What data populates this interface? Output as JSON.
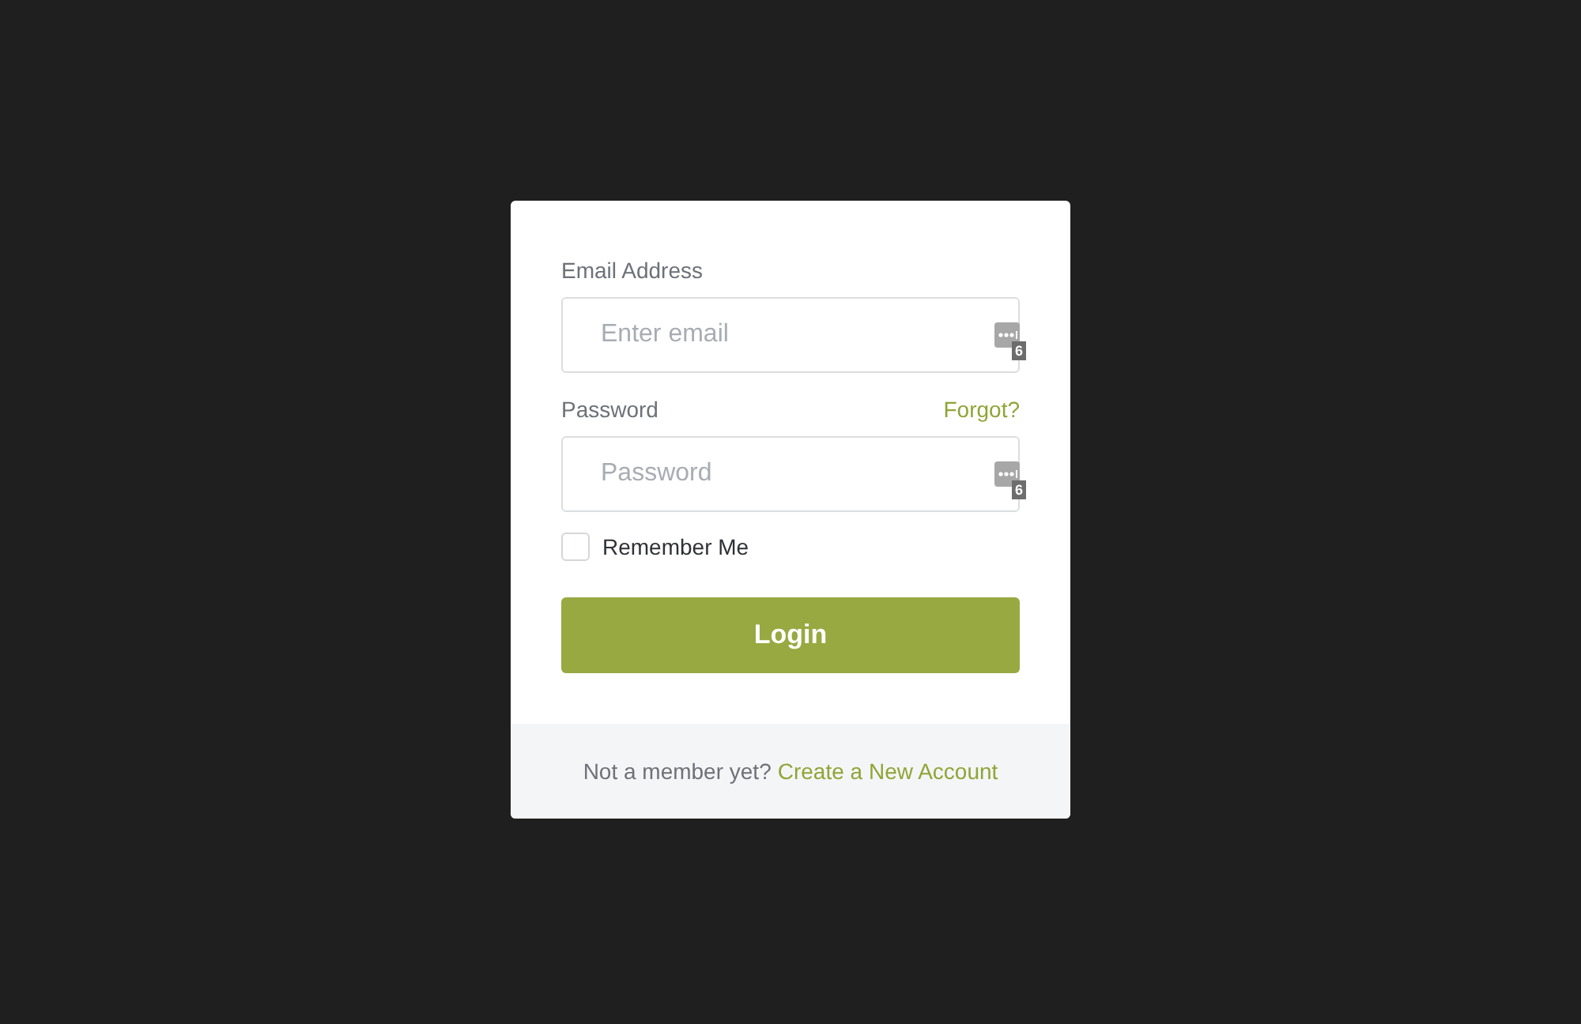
{
  "form": {
    "fields": [
      {
        "label": "Email Address",
        "placeholder": "Enter email",
        "badge": "6"
      },
      {
        "label": "Password",
        "link": "Forgot?",
        "placeholder": "Password",
        "badge": "6"
      }
    ],
    "remember": {
      "label": "Remember Me",
      "checked": false
    },
    "submit": "Login"
  },
  "footer": {
    "text": "Not a member yet?",
    "link": "Create a New Account"
  }
}
